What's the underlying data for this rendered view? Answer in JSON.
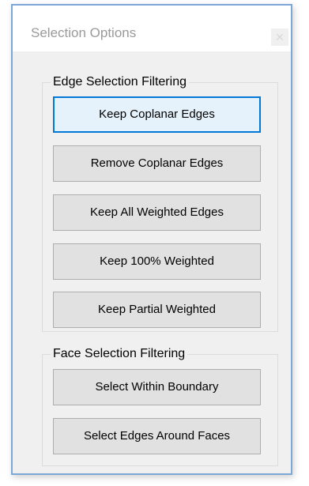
{
  "window": {
    "title": "Selection Options",
    "close_glyph": "✕"
  },
  "edge_group": {
    "legend": "Edge Selection Filtering",
    "buttons": [
      {
        "label": "Keep Coplanar Edges"
      },
      {
        "label": "Remove Coplanar Edges"
      },
      {
        "label": "Keep All Weighted Edges"
      },
      {
        "label": "Keep 100% Weighted"
      },
      {
        "label": "Keep Partial Weighted"
      }
    ]
  },
  "face_group": {
    "legend": "Face Selection Filtering",
    "buttons": [
      {
        "label": "Select Within Boundary"
      },
      {
        "label": "Select Edges Around Faces"
      }
    ]
  },
  "colors": {
    "window_border": "#7da7d9",
    "focus_border": "#0078d7",
    "button_face": "#e1e1e1"
  },
  "focused_button": "Keep Coplanar Edges"
}
